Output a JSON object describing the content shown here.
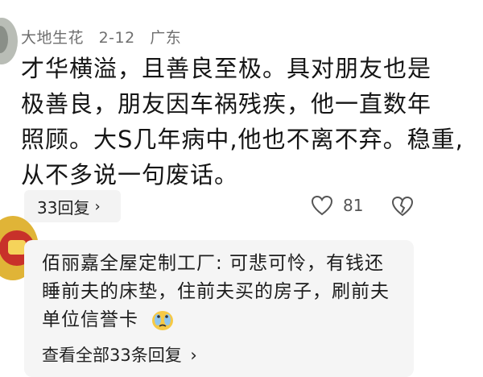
{
  "comment": {
    "author": "大地生花",
    "date": "2-12",
    "location": "广东",
    "text_lines": [
      "才华横溢，且善良至极。具对朋友也是",
      "极善良，朋友因车祸残疾，他一直数年",
      "照顾。大S几年病中,他也不离不弃。稳重,",
      "从不多说一句废话。"
    ],
    "replies_label": "33回复",
    "like_count": "81"
  },
  "reply_preview": {
    "text_lines": [
      "佰丽嘉全屋定制工厂: 可悲可怜，有钱还",
      "睡前夫的床垫，住前夫买的房子，刷前夫",
      "单位信誉卡"
    ],
    "view_all_label": "查看全部33条回复"
  },
  "icons": {
    "reply_chevron": "chevron-right-icon",
    "like": "heart-icon",
    "dislike": "broken-heart-icon",
    "emoji": "crying-face-emoji-icon"
  }
}
